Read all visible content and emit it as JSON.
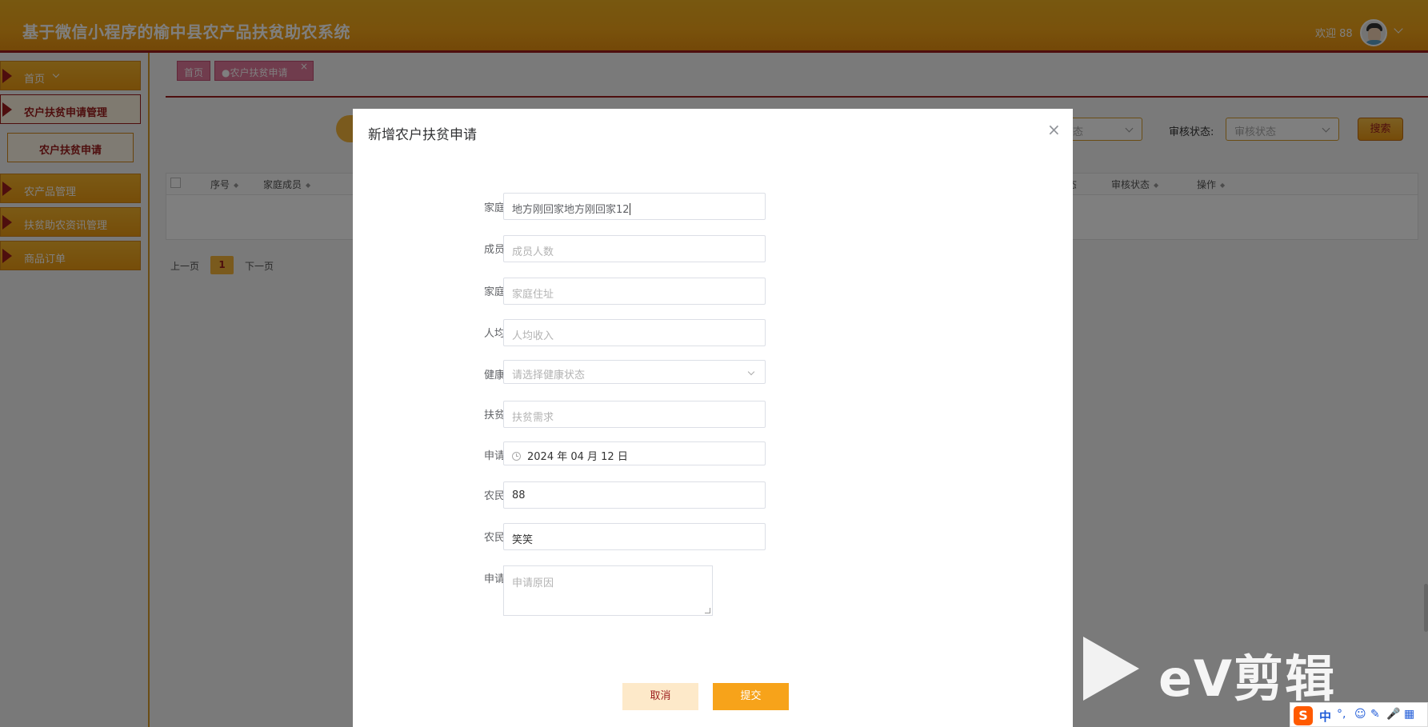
{
  "header": {
    "title": "基于微信小程序的榆中县农产品扶贫助农系统",
    "welcome": "欢迎 88"
  },
  "sidebar": {
    "items": [
      {
        "label": "首页"
      },
      {
        "label": "农户扶贫申请管理"
      },
      {
        "label": "农户扶贫申请"
      },
      {
        "label": "农产品管理"
      },
      {
        "label": "扶贫助农资讯管理"
      },
      {
        "label": "商品订单"
      }
    ]
  },
  "tabs": [
    {
      "label": "首页"
    },
    {
      "label": "●农户扶贫申请",
      "close": "×"
    }
  ],
  "search": {
    "status_partial": "态",
    "audit_label": "审核状态:",
    "audit_placeholder": "审核状态",
    "button": "搜索"
  },
  "table": {
    "headers": [
      "序号",
      "家庭成员",
      "审核状态",
      "操作"
    ],
    "partial_header": "态",
    "sort_glyph": "◆"
  },
  "pagination": {
    "prev": "上一页",
    "current": "1",
    "next": "下一页"
  },
  "modal": {
    "title": "新增农户扶贫申请",
    "close": "×",
    "fields": [
      {
        "label": "家庭成员",
        "value": "地方刚回家地方刚回家12",
        "placeholder": ""
      },
      {
        "label": "成员人数",
        "value": "",
        "placeholder": "成员人数"
      },
      {
        "label": "家庭住址",
        "value": "",
        "placeholder": "家庭住址"
      },
      {
        "label": "人均收入",
        "value": "",
        "placeholder": "人均收入"
      },
      {
        "label": "健康状态",
        "value": "",
        "placeholder": "请选择健康状态"
      },
      {
        "label": "扶贫需求",
        "value": "",
        "placeholder": "扶贫需求"
      },
      {
        "label": "申请日期",
        "value": "2024 年 04 月 12 日",
        "placeholder": ""
      },
      {
        "label": "农民账号",
        "value": "88",
        "placeholder": ""
      },
      {
        "label": "农民姓名",
        "value": "笑笑",
        "placeholder": ""
      },
      {
        "label": "申请原因",
        "value": "",
        "placeholder": "申请原因"
      }
    ],
    "cancel": "取消",
    "submit": "提交"
  },
  "watermark": {
    "text": "eV剪辑"
  },
  "tray": {
    "logo": "S",
    "ime": "中",
    "icons": [
      "°,",
      "☺",
      "✎",
      "🎤",
      "▦"
    ]
  },
  "colors": {
    "header": "#f2a418",
    "accent": "#9c1c1c",
    "submit": "#f7a31a",
    "cancel_bg": "#fde9c9"
  }
}
